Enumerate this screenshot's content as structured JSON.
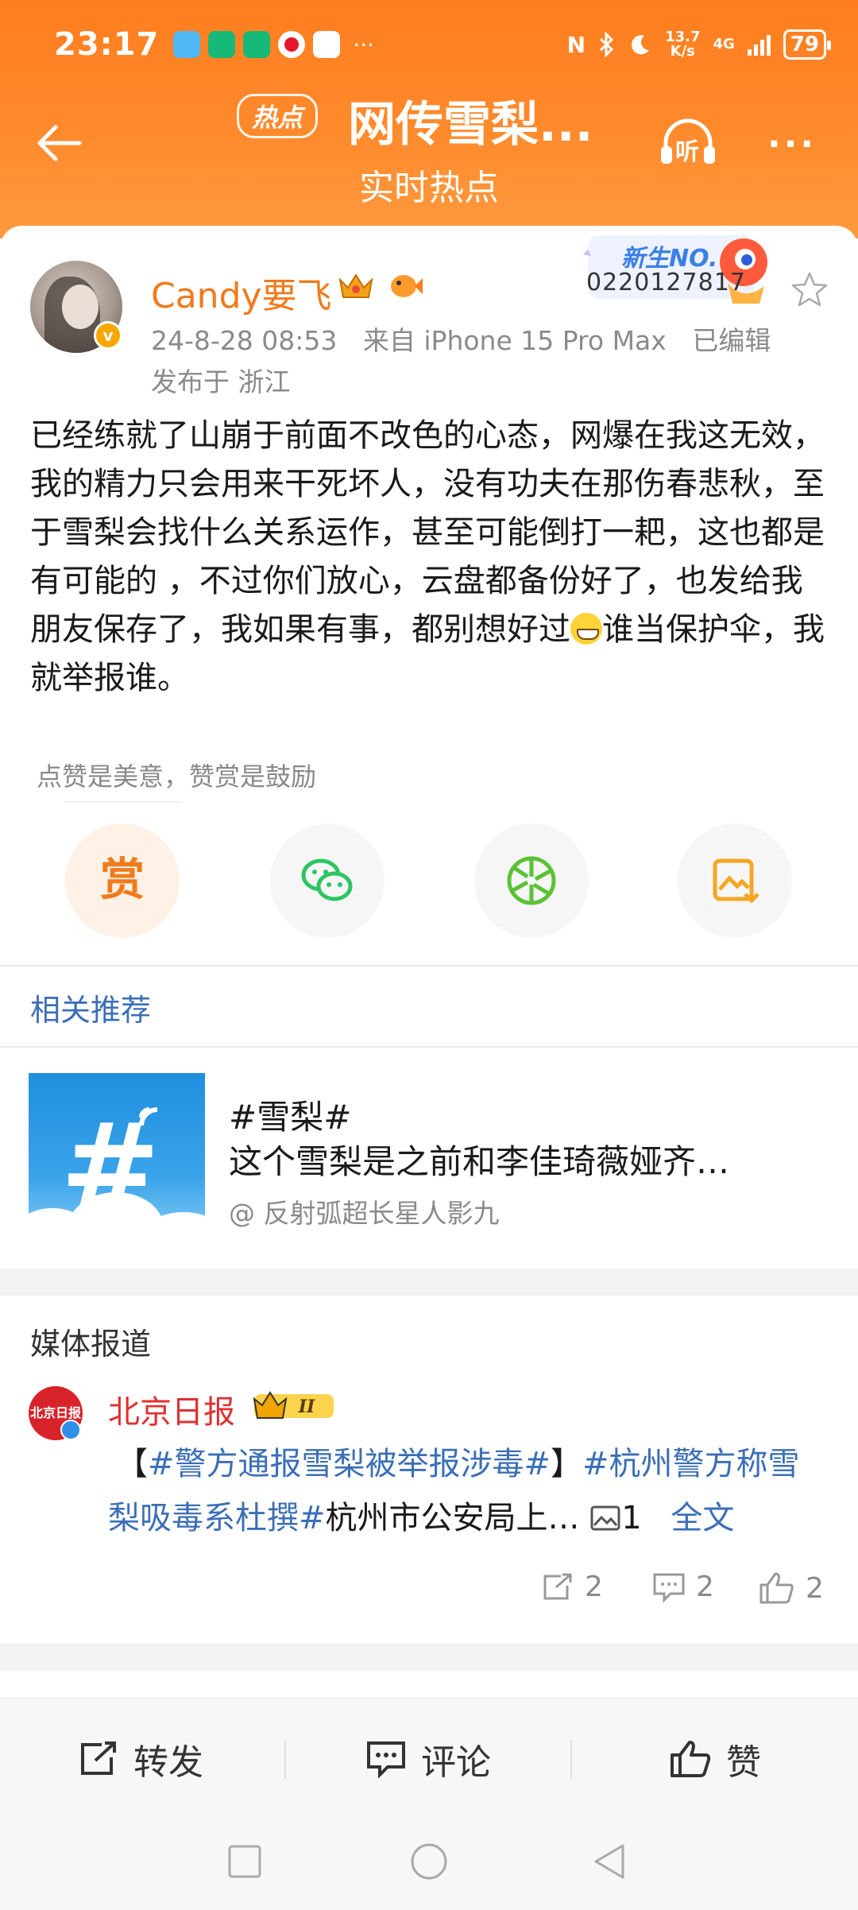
{
  "status_bar": {
    "time": "23:17",
    "net_speed_value": "13.7",
    "net_speed_unit": "K/s",
    "net_type": "4G",
    "battery": "79"
  },
  "nav": {
    "hot_badge": "热点",
    "title": "网传雪梨...",
    "subtitle": "实时热点",
    "listen_label": "听"
  },
  "post": {
    "username": "Candy要飞",
    "date": "24-8-28 08:53",
    "source": "来自 iPhone 15 Pro Max",
    "edited": "已编辑",
    "location": "发布于 浙江",
    "newbie_title": "新生NO.",
    "newbie_number": "0220127817",
    "text_before_emoji": "已经练就了山崩于前面不改色的心态，网爆在我这无效，我的精力只会用来干死坏人，没有功夫在那伤春悲秋，至于雪梨会找什么关系运作，甚至可能倒打一耙，这也都是有可能的 ，不过你们放心，云盘都备份好了，也发给我朋友保存了，我如果有事，都别想好过",
    "text_after_emoji": "谁当保护伞，我就举报谁。"
  },
  "reward": {
    "hint": "点赞是美意，赞赏是鼓励",
    "reward_label": "赏"
  },
  "related": {
    "title": "相关推荐",
    "tag": "#雪梨#",
    "text": "这个雪梨是之前和李佳琦薇娅齐…",
    "source": "@ 反射弧超长星人影九"
  },
  "media": {
    "title": "媒体报道",
    "outlet": "北京日报",
    "outlet_logo_text": "北京日报",
    "rank_badge": "II",
    "open_bracket": "【",
    "hashtag1": "#警方通报雪梨被举报涉毒#",
    "close_bracket": "】",
    "hashtag2": "#杭州警方称雪梨吸毒系杜撰#",
    "snippet": "杭州市公安局上…",
    "image_count": "1",
    "full_text": "全文",
    "reposts": "2",
    "comments": "2",
    "likes": "2"
  },
  "toolbar": {
    "repost": "转发",
    "comment": "评论",
    "like": "赞"
  },
  "colors": {
    "header_orange": "#ff8a2c",
    "username_orange": "#f07a1c",
    "link_blue": "#3b6fb6",
    "outlet_red": "#e03030"
  }
}
